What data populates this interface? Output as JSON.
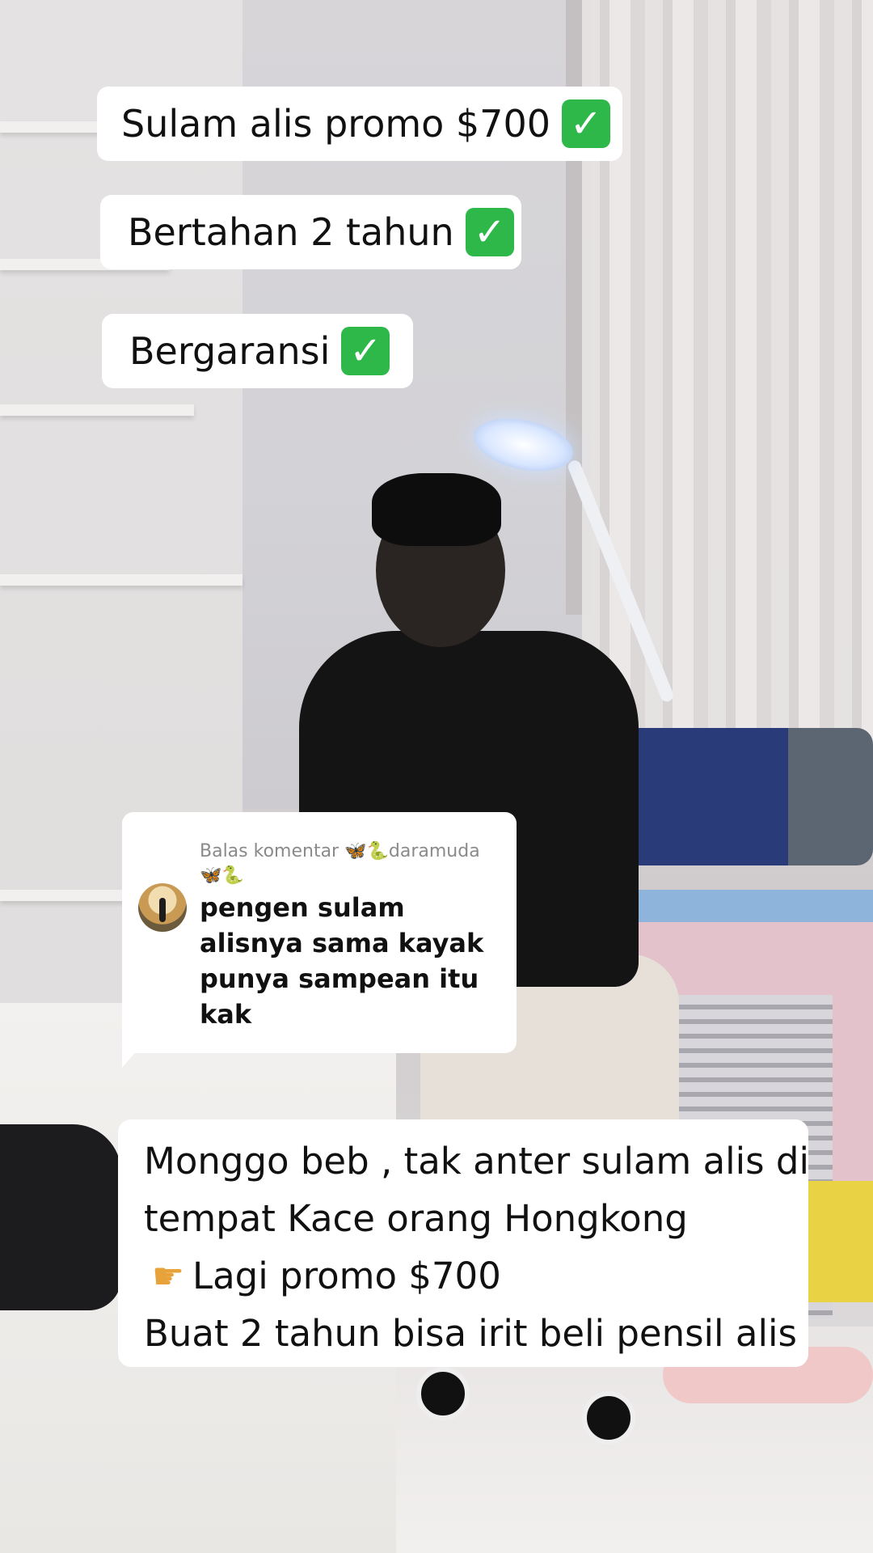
{
  "overlays": {
    "tag1": {
      "text": "Sulam alis promo $700",
      "icon": "check-mark-button-emoji"
    },
    "tag2": {
      "text": "Bertahan 2 tahun",
      "icon": "check-mark-button-emoji"
    },
    "tag3": {
      "text": "Bergaransi",
      "icon": "check-mark-button-emoji"
    }
  },
  "reply": {
    "prefix": "Balas komentar",
    "username": "daramuda",
    "username_emoji": "🦋🐍",
    "comment": "pengen sulam alisnya sama kayak punya sampean itu kak"
  },
  "caption": {
    "line1": "Monggo beb , tak anter sulam alis di",
    "line2": "tempat Kace orang Hongkong",
    "line3_icon": "pointing-hand-emoji",
    "line3": "Lagi promo $700",
    "line4": "Buat 2 tahun bisa irit beli pensil alis"
  },
  "colors": {
    "check_green": "#2fb84a",
    "bubble_white": "#ffffff",
    "muted_gray": "#8a8a8a"
  }
}
